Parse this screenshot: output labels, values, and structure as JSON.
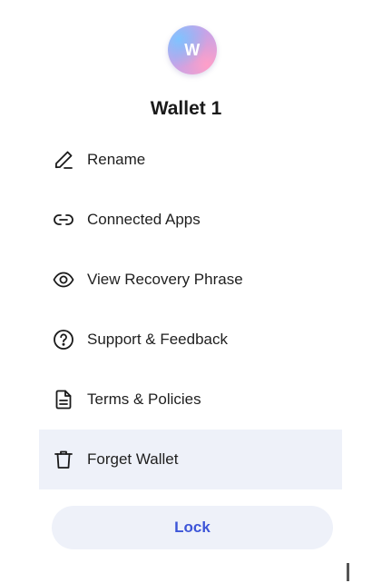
{
  "avatar": {
    "initial": "W"
  },
  "wallet": {
    "name": "Wallet 1"
  },
  "menu": {
    "items": [
      {
        "label": "Rename",
        "icon": "pencil-icon"
      },
      {
        "label": "Connected Apps",
        "icon": "link-icon"
      },
      {
        "label": "View Recovery Phrase",
        "icon": "eye-icon"
      },
      {
        "label": "Support & Feedback",
        "icon": "question-circle-icon"
      },
      {
        "label": "Terms & Policies",
        "icon": "document-icon"
      },
      {
        "label": "Forget Wallet",
        "icon": "trash-icon",
        "highlighted": true
      }
    ]
  },
  "lock": {
    "label": "Lock"
  },
  "colors": {
    "accent": "#3d55d8",
    "highlight_bg": "#eef1f9",
    "text": "#1a1a1a"
  }
}
